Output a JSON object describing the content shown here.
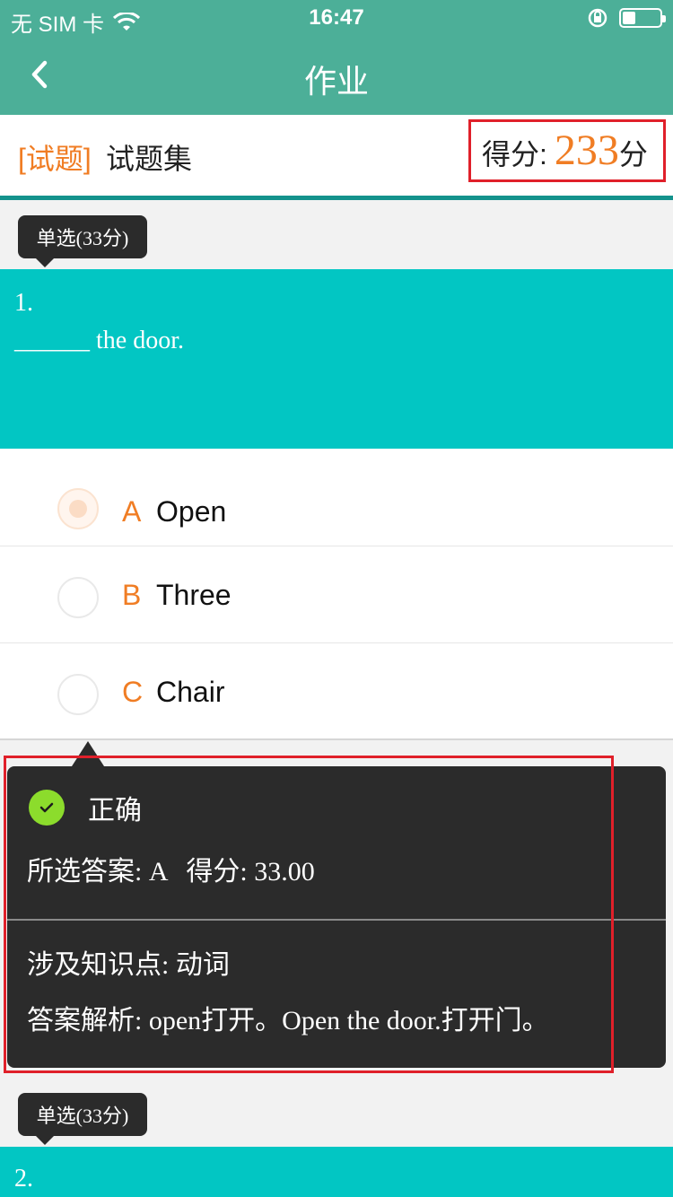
{
  "status_bar": {
    "carrier": "无 SIM 卡",
    "time": "16:47",
    "battery_level": 0.35
  },
  "nav": {
    "title": "作业",
    "back_icon": "chevron-left-icon"
  },
  "header": {
    "tag": "[试题]",
    "set_name": "试题集",
    "score_label": "得分:",
    "score_value": "233",
    "score_unit": "分"
  },
  "questions": [
    {
      "tag": "单选(33分)",
      "number": "1.",
      "text": "______ the door.",
      "options": [
        {
          "letter": "A",
          "text": "Open",
          "selected": true
        },
        {
          "letter": "B",
          "text": "Three",
          "selected": false
        },
        {
          "letter": "C",
          "text": "Chair",
          "selected": false
        }
      ],
      "result": {
        "status": "正确",
        "answer_label": "所选答案:",
        "answer_value": "A",
        "score_label": "得分:",
        "score_value": "33.00",
        "knowledge_label": "涉及知识点:",
        "knowledge_value": "动词",
        "analysis_label": "答案解析:",
        "analysis_value": "open打开。Open the door.打开门。"
      }
    },
    {
      "tag": "单选(33分)",
      "number": "2."
    }
  ],
  "colors": {
    "header_green": "#4caf98",
    "question_teal": "#02c6c3",
    "accent_orange": "#f07d24",
    "highlight_red": "#e0202a",
    "correct_green": "#8cdc2c"
  }
}
